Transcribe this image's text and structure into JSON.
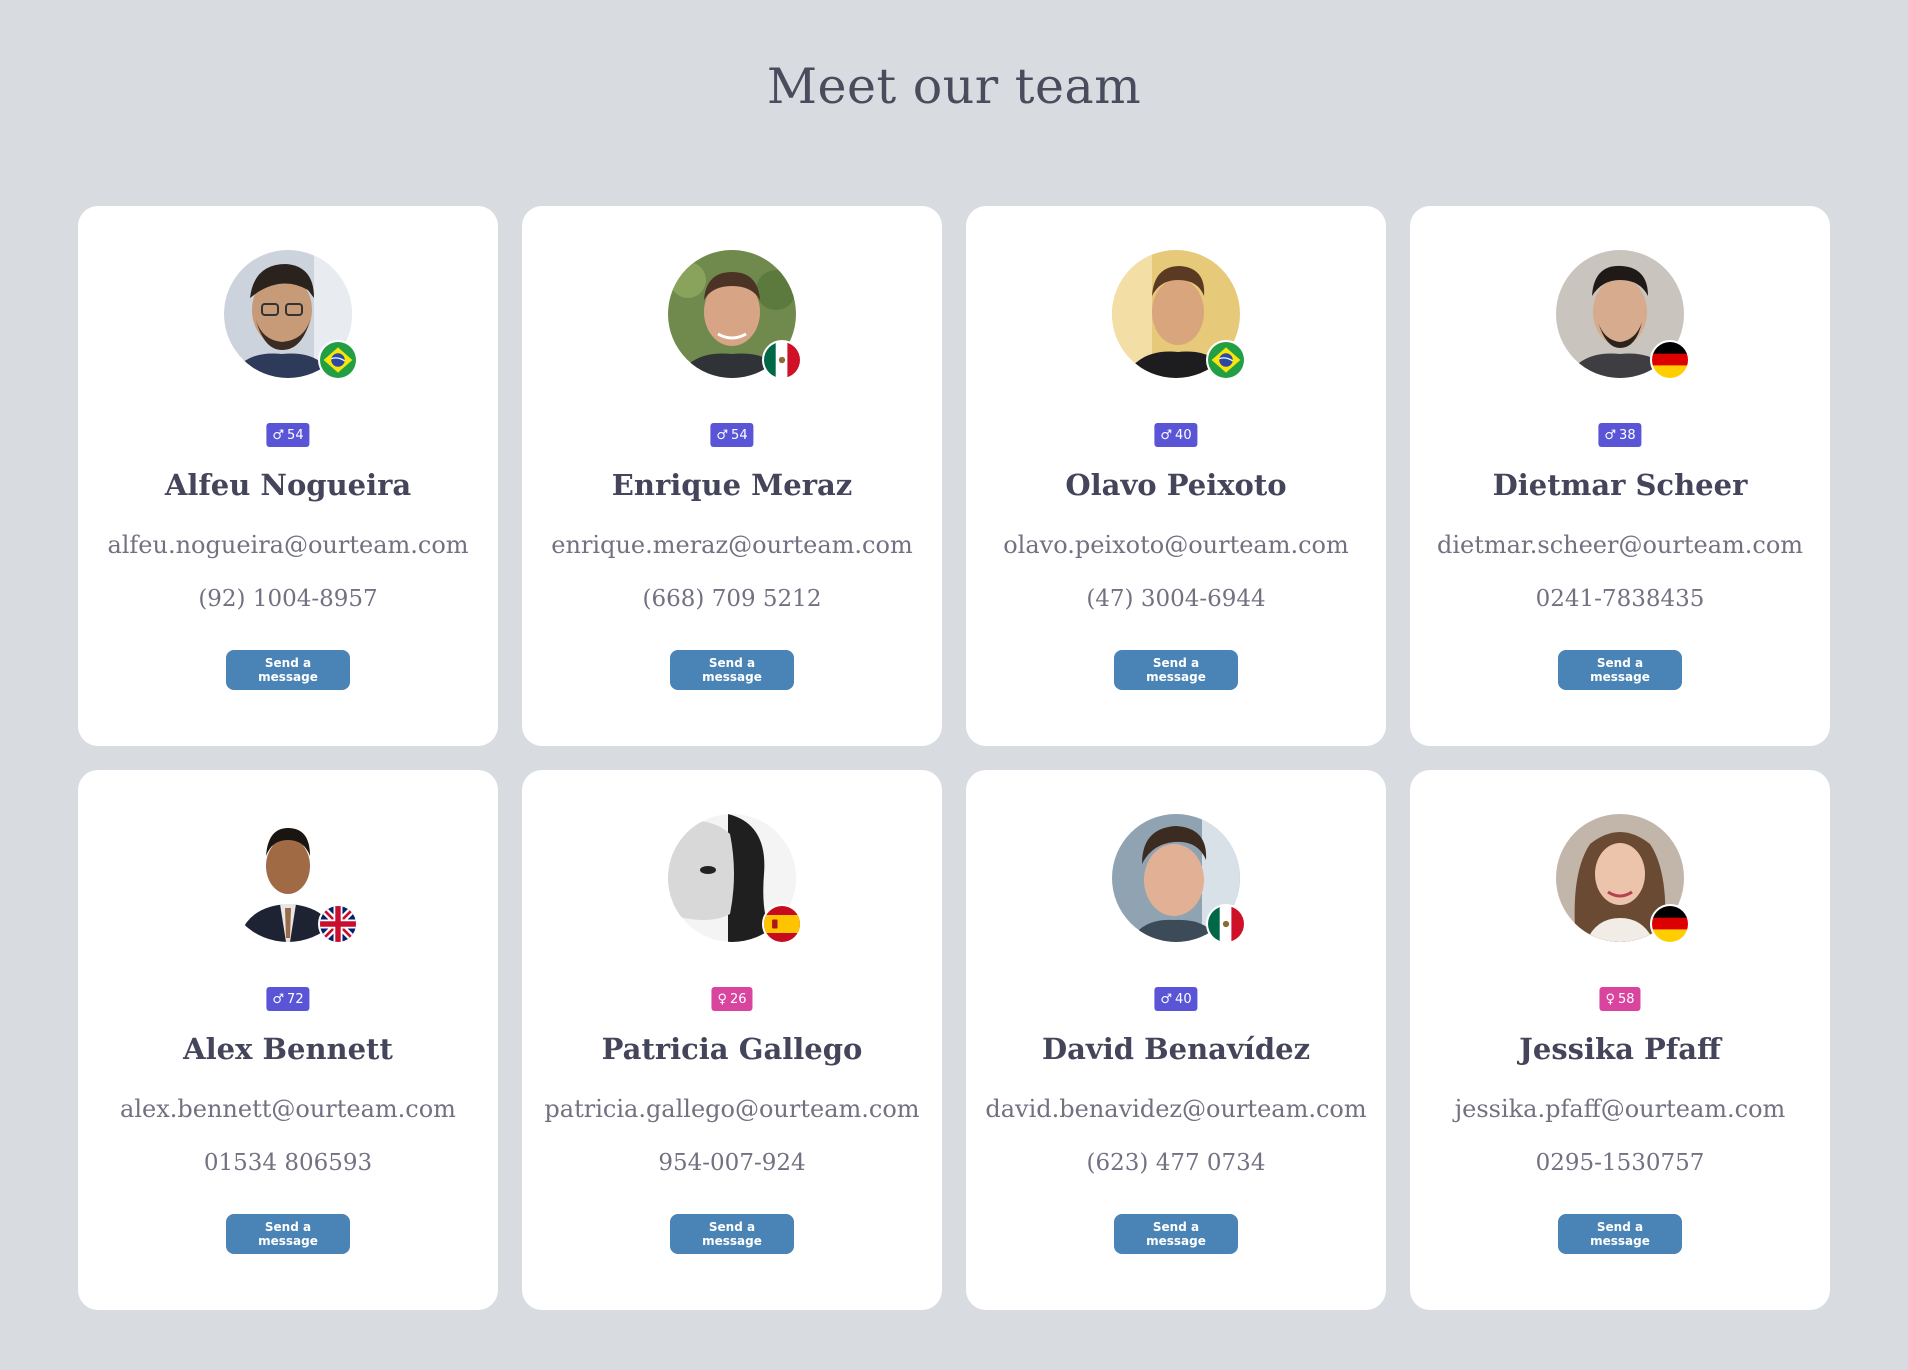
{
  "page": {
    "title": "Meet our team"
  },
  "colors": {
    "background": "#d8dce0",
    "card": "#ffffff",
    "button": "#4a83b5",
    "male_badge": "#5a55d6",
    "female_badge": "#d9449e"
  },
  "team": [
    {
      "name": "Alfeu Nogueira",
      "email": "alfeu.nogueira@ourteam.com",
      "phone": "(92) 1004-8957",
      "gender_symbol": "♂",
      "age": "54",
      "flag": "brazil-flag-icon",
      "button_label": "Send a message"
    },
    {
      "name": "Enrique Meraz",
      "email": "enrique.meraz@ourteam.com",
      "phone": "(668) 709 5212",
      "gender_symbol": "♂",
      "age": "54",
      "flag": "mexico-flag-icon",
      "button_label": "Send a message"
    },
    {
      "name": "Olavo Peixoto",
      "email": "olavo.peixoto@ourteam.com",
      "phone": "(47) 3004-6944",
      "gender_symbol": "♂",
      "age": "40",
      "flag": "brazil-flag-icon",
      "button_label": "Send a message"
    },
    {
      "name": "Dietmar Scheer",
      "email": "dietmar.scheer@ourteam.com",
      "phone": "0241-7838435",
      "gender_symbol": "♂",
      "age": "38",
      "flag": "germany-flag-icon",
      "button_label": "Send a message"
    },
    {
      "name": "Alex Bennett",
      "email": "alex.bennett@ourteam.com",
      "phone": "01534 806593",
      "gender_symbol": "♂",
      "age": "72",
      "flag": "uk-flag-icon",
      "button_label": "Send a message"
    },
    {
      "name": "Patricia Gallego",
      "email": "patricia.gallego@ourteam.com",
      "phone": "954-007-924",
      "gender_symbol": "♀",
      "age": "26",
      "flag": "spain-flag-icon",
      "button_label": "Send a message"
    },
    {
      "name": "David Benavídez",
      "email": "david.benavidez@ourteam.com",
      "phone": "(623) 477 0734",
      "gender_symbol": "♂",
      "age": "40",
      "flag": "mexico-flag-icon",
      "button_label": "Send a message"
    },
    {
      "name": "Jessika Pfaff",
      "email": "jessika.pfaff@ourteam.com",
      "phone": "0295-1530757",
      "gender_symbol": "♀",
      "age": "58",
      "flag": "germany-flag-icon",
      "button_label": "Send a message"
    }
  ]
}
